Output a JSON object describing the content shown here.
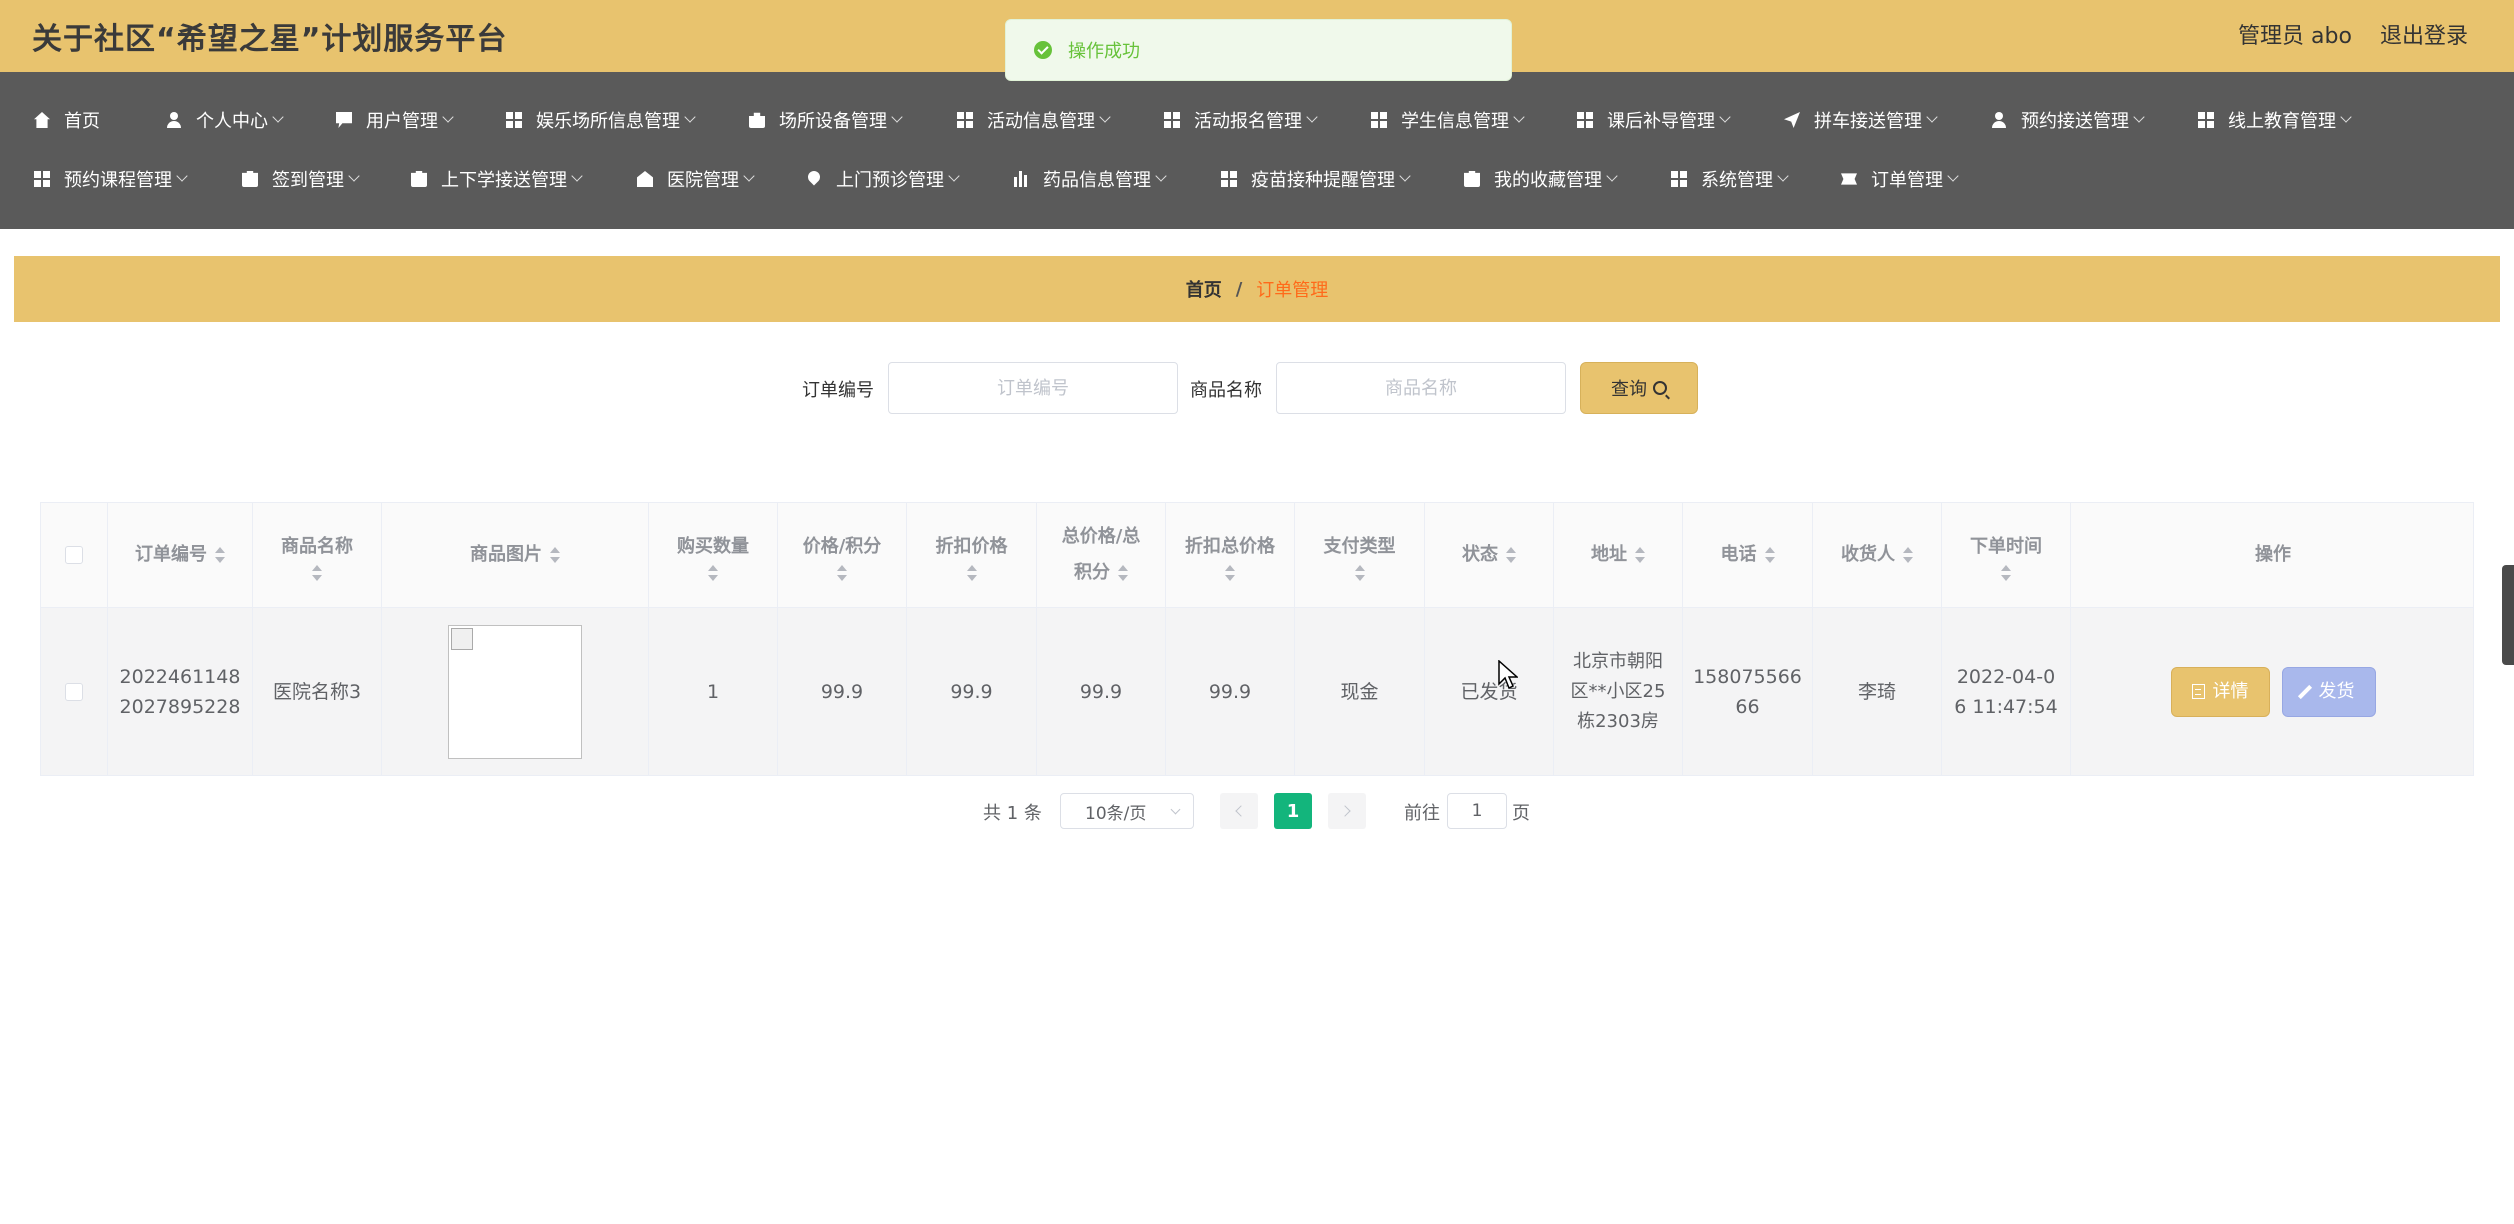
{
  "header": {
    "title": "关于社区“希望之星”计划服务平台",
    "admin": "管理员 abo",
    "logout": "退出登录"
  },
  "toast": {
    "message": "操作成功",
    "color": "#67c23a"
  },
  "nav": {
    "row1": [
      {
        "label": "首页",
        "icon": "home-icon"
      },
      {
        "label": "个人中心",
        "icon": "user-icon"
      },
      {
        "label": "用户管理",
        "icon": "chat-icon"
      },
      {
        "label": "娱乐场所信息管理",
        "icon": "grid-icon"
      },
      {
        "label": "场所设备管理",
        "icon": "briefcase-icon"
      },
      {
        "label": "活动信息管理",
        "icon": "grid-icon"
      },
      {
        "label": "活动报名管理",
        "icon": "grid-icon"
      },
      {
        "label": "学生信息管理",
        "icon": "grid-icon"
      },
      {
        "label": "课后补导管理",
        "icon": "grid-icon"
      },
      {
        "label": "拼车接送管理",
        "icon": "plane-icon"
      },
      {
        "label": "预约接送管理",
        "icon": "user-icon"
      },
      {
        "label": "线上教育管理",
        "icon": "grid-icon"
      }
    ],
    "row2": [
      {
        "label": "预约课程管理",
        "icon": "grid-icon"
      },
      {
        "label": "签到管理",
        "icon": "clipboard-icon"
      },
      {
        "label": "上下学接送管理",
        "icon": "clipboard-icon"
      },
      {
        "label": "医院管理",
        "icon": "hospital-icon"
      },
      {
        "label": "上门预诊管理",
        "icon": "pin-icon"
      },
      {
        "label": "药品信息管理",
        "icon": "bar-chart-icon"
      },
      {
        "label": "疫苗接种提醒管理",
        "icon": "grid-icon"
      },
      {
        "label": "我的收藏管理",
        "icon": "clipboard-icon"
      },
      {
        "label": "系统管理",
        "icon": "grid-icon"
      },
      {
        "label": "订单管理",
        "icon": "ticket-icon"
      }
    ]
  },
  "breadcrumb": {
    "home": "首页",
    "separator": "/",
    "current": "订单管理"
  },
  "search": {
    "order_label": "订单编号",
    "order_placeholder": "订单编号",
    "product_label": "商品名称",
    "product_placeholder": "商品名称",
    "query_label": "查询"
  },
  "table": {
    "headers": {
      "order_no": "订单编号",
      "product_name": "商品名称",
      "product_image": "商品图片",
      "quantity": "购买数量",
      "price_l1": "价格/积分",
      "discount_price": "折扣价格",
      "total_l1": "总价格/总",
      "total_l2": "积分",
      "discount_total": "折扣总价格",
      "pay_type": "支付类型",
      "status": "状态",
      "address": "地址",
      "phone": "电话",
      "receiver": "收货人",
      "order_time": "下单时间",
      "actions": "操作"
    },
    "rows": [
      {
        "order_no_l1": "2022461148",
        "order_no_l2": "2027895228",
        "product_name": "医院名称3",
        "quantity": "1",
        "price": "99.9",
        "discount_price": "99.9",
        "total": "99.9",
        "discount_total": "99.9",
        "pay_type": "现金",
        "status": "已发货",
        "address_l1": "北京市朝阳",
        "address_l2": "区**小区25",
        "address_l3": "栋2303房",
        "phone_l1": "158075566",
        "phone_l2": "66",
        "receiver": "李琦",
        "time_l1": "2022-04-0",
        "time_l2": "6 11:47:54",
        "detail_label": "详情",
        "ship_label": "发货"
      }
    ]
  },
  "pager": {
    "total": "共 1 条",
    "page_size": "10条/页",
    "current_page": "1",
    "goto_label": "前往",
    "goto_value": "1",
    "page_unit": "页"
  },
  "colors": {
    "header_bg": "#e8c36e",
    "nav_bg": "#5a5a5a",
    "accent": "#e8c36e",
    "current_crumb": "#ff6a1a",
    "pager_active": "#13b57c",
    "ship_button": "#a9b8ec"
  }
}
